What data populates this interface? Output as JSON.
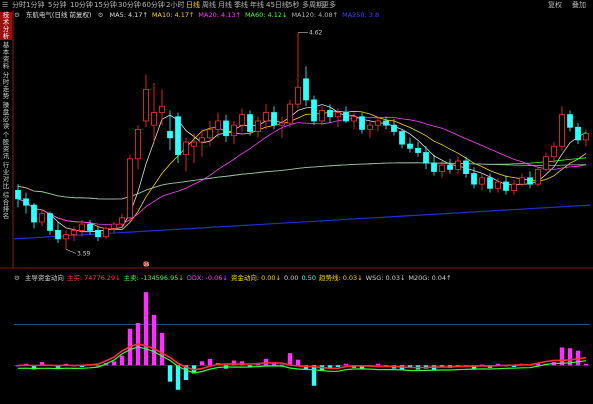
{
  "toolbar": {
    "items": [
      {
        "label": "分时",
        "active": false
      },
      {
        "label": "1分钟",
        "active": false
      },
      {
        "label": "5分钟",
        "active": false
      },
      {
        "label": "10分钟",
        "active": false
      },
      {
        "label": "15分钟",
        "active": false
      },
      {
        "label": "30分钟",
        "active": false
      },
      {
        "label": "60分钟",
        "active": false
      },
      {
        "label": "2小时",
        "active": false
      },
      {
        "label": "日线",
        "active": true
      },
      {
        "label": "周线",
        "active": false
      },
      {
        "label": "月线",
        "active": false
      },
      {
        "label": "季线",
        "active": false
      },
      {
        "label": "年线",
        "active": false
      },
      {
        "label": "45日线",
        "active": false
      },
      {
        "label": "5秒",
        "active": false
      },
      {
        "label": "多周期",
        "active": false
      },
      {
        "label": "更多",
        "active": false
      }
    ],
    "right_items": [
      "复权",
      "叠加"
    ]
  },
  "sidebar": [
    {
      "label": "技术分析",
      "hot": true
    },
    {
      "label": "基本资料",
      "hot": false
    },
    {
      "label": "分时走势",
      "hot": false
    },
    {
      "label": "操盘必读",
      "hot": false
    },
    {
      "label": "个股资讯",
      "hot": false
    },
    {
      "label": "行业对比",
      "hot": false
    },
    {
      "label": "综合排名",
      "hot": false
    }
  ],
  "main_legend": {
    "title": "东航电气(日线 前复权)",
    "items": [
      {
        "label": "MA5: 4.17↑",
        "color": "#e0e0e0"
      },
      {
        "label": "MA10: 4.17↑",
        "color": "#ffd700"
      },
      {
        "label": "MA20: 4.13↑",
        "color": "#ff40ff"
      },
      {
        "label": "MA60: 4.12↓",
        "color": "#40ff40"
      },
      {
        "label": "MA120: 4.08↑",
        "color": "#b0b0b0"
      },
      {
        "label": "MA250: 3.8",
        "color": "#4040ff"
      }
    ]
  },
  "sub_legend": {
    "items": [
      {
        "label": "主导资金动向",
        "color": "#d0d0d0"
      },
      {
        "label": "主买: 74776.29↓",
        "color": "#ff4040"
      },
      {
        "label": "主卖: -134596.95↓",
        "color": "#40ff40"
      },
      {
        "label": "DDX: -0.06↓",
        "color": "#ff40ff"
      },
      {
        "label": "资金动向: 0.00↓",
        "color": "#ffd700"
      },
      {
        "label": "0.00",
        "color": "#d0d0d0"
      },
      {
        "label": "0.50",
        "color": "#40ffff"
      },
      {
        "label": "趋势线: 0.03↓",
        "color": "#ffd700"
      },
      {
        "label": "WSG: 0.03↓",
        "color": "#d0d0d0"
      },
      {
        "label": "M20G: 0.04↑",
        "color": "#d0d0d0"
      }
    ]
  },
  "annotations": {
    "high_label": "4.62",
    "low_label": "3.59",
    "marker": "26"
  },
  "colors": {
    "up": "#ff3030",
    "down": "#30ffff",
    "bg": "#000000",
    "volume_line": "#4080c0"
  },
  "chart_data": {
    "type": "candlestick",
    "ylim": [
      3.53,
      4.67
    ],
    "candles": [
      {
        "o": 3.87,
        "h": 3.9,
        "l": 3.79,
        "c": 3.83
      },
      {
        "o": 3.83,
        "h": 3.86,
        "l": 3.76,
        "c": 3.8
      },
      {
        "o": 3.8,
        "h": 3.81,
        "l": 3.69,
        "c": 3.72
      },
      {
        "o": 3.72,
        "h": 3.78,
        "l": 3.7,
        "c": 3.76
      },
      {
        "o": 3.76,
        "h": 3.77,
        "l": 3.66,
        "c": 3.68
      },
      {
        "o": 3.68,
        "h": 3.72,
        "l": 3.62,
        "c": 3.64
      },
      {
        "o": 3.64,
        "h": 3.68,
        "l": 3.59,
        "c": 3.66
      },
      {
        "o": 3.66,
        "h": 3.7,
        "l": 3.63,
        "c": 3.68
      },
      {
        "o": 3.68,
        "h": 3.73,
        "l": 3.65,
        "c": 3.71
      },
      {
        "o": 3.71,
        "h": 3.73,
        "l": 3.66,
        "c": 3.68
      },
      {
        "o": 3.68,
        "h": 3.7,
        "l": 3.63,
        "c": 3.65
      },
      {
        "o": 3.65,
        "h": 3.7,
        "l": 3.64,
        "c": 3.69
      },
      {
        "o": 3.69,
        "h": 3.72,
        "l": 3.67,
        "c": 3.71
      },
      {
        "o": 3.71,
        "h": 3.76,
        "l": 3.69,
        "c": 3.74
      },
      {
        "o": 3.74,
        "h": 4.04,
        "l": 3.72,
        "c": 4.02
      },
      {
        "o": 4.02,
        "h": 4.18,
        "l": 3.97,
        "c": 4.16
      },
      {
        "o": 4.2,
        "h": 4.42,
        "l": 4.17,
        "c": 4.35
      },
      {
        "o": 4.18,
        "h": 4.38,
        "l": 4.1,
        "c": 4.24
      },
      {
        "o": 4.24,
        "h": 4.35,
        "l": 4.18,
        "c": 4.27
      },
      {
        "o": 4.15,
        "h": 4.25,
        "l": 4.06,
        "c": 4.12
      },
      {
        "o": 4.22,
        "h": 4.24,
        "l": 4.0,
        "c": 4.04
      },
      {
        "o": 4.04,
        "h": 4.12,
        "l": 3.96,
        "c": 4.1
      },
      {
        "o": 4.08,
        "h": 4.14,
        "l": 4.0,
        "c": 4.1
      },
      {
        "o": 4.1,
        "h": 4.16,
        "l": 4.03,
        "c": 4.12
      },
      {
        "o": 4.12,
        "h": 4.2,
        "l": 4.08,
        "c": 4.16
      },
      {
        "o": 4.16,
        "h": 4.24,
        "l": 4.12,
        "c": 4.2
      },
      {
        "o": 4.2,
        "h": 4.23,
        "l": 4.1,
        "c": 4.13
      },
      {
        "o": 4.13,
        "h": 4.2,
        "l": 4.09,
        "c": 4.18
      },
      {
        "o": 4.18,
        "h": 4.26,
        "l": 4.15,
        "c": 4.23
      },
      {
        "o": 4.23,
        "h": 4.25,
        "l": 4.13,
        "c": 4.15
      },
      {
        "o": 4.15,
        "h": 4.22,
        "l": 4.12,
        "c": 4.2
      },
      {
        "o": 4.2,
        "h": 4.28,
        "l": 4.16,
        "c": 4.24
      },
      {
        "o": 4.24,
        "h": 4.27,
        "l": 4.16,
        "c": 4.18
      },
      {
        "o": 4.18,
        "h": 4.22,
        "l": 4.12,
        "c": 4.19
      },
      {
        "o": 4.19,
        "h": 4.3,
        "l": 4.17,
        "c": 4.28
      },
      {
        "o": 4.28,
        "h": 4.62,
        "l": 4.26,
        "c": 4.36
      },
      {
        "o": 4.4,
        "h": 4.46,
        "l": 4.27,
        "c": 4.3
      },
      {
        "o": 4.3,
        "h": 4.32,
        "l": 4.18,
        "c": 4.2
      },
      {
        "o": 4.2,
        "h": 4.27,
        "l": 4.18,
        "c": 4.25
      },
      {
        "o": 4.25,
        "h": 4.28,
        "l": 4.19,
        "c": 4.22
      },
      {
        "o": 4.22,
        "h": 4.26,
        "l": 4.17,
        "c": 4.24
      },
      {
        "o": 4.24,
        "h": 4.27,
        "l": 4.19,
        "c": 4.2
      },
      {
        "o": 4.2,
        "h": 4.24,
        "l": 4.16,
        "c": 4.22
      },
      {
        "o": 4.22,
        "h": 4.24,
        "l": 4.14,
        "c": 4.16
      },
      {
        "o": 4.16,
        "h": 4.2,
        "l": 4.12,
        "c": 4.18
      },
      {
        "o": 4.18,
        "h": 4.22,
        "l": 4.15,
        "c": 4.2
      },
      {
        "o": 4.2,
        "h": 4.22,
        "l": 4.16,
        "c": 4.18
      },
      {
        "o": 4.18,
        "h": 4.21,
        "l": 4.13,
        "c": 4.15
      },
      {
        "o": 4.15,
        "h": 4.16,
        "l": 4.07,
        "c": 4.09
      },
      {
        "o": 4.09,
        "h": 4.12,
        "l": 4.05,
        "c": 4.07
      },
      {
        "o": 4.07,
        "h": 4.1,
        "l": 4.03,
        "c": 4.05
      },
      {
        "o": 4.05,
        "h": 4.08,
        "l": 3.97,
        "c": 4.0
      },
      {
        "o": 4.0,
        "h": 4.04,
        "l": 3.94,
        "c": 3.96
      },
      {
        "o": 3.96,
        "h": 4.01,
        "l": 3.93,
        "c": 3.99
      },
      {
        "o": 3.99,
        "h": 4.02,
        "l": 3.95,
        "c": 3.97
      },
      {
        "o": 3.97,
        "h": 4.03,
        "l": 3.95,
        "c": 4.01
      },
      {
        "o": 4.01,
        "h": 4.03,
        "l": 3.93,
        "c": 3.95
      },
      {
        "o": 3.95,
        "h": 3.98,
        "l": 3.88,
        "c": 3.9
      },
      {
        "o": 3.9,
        "h": 3.95,
        "l": 3.87,
        "c": 3.93
      },
      {
        "o": 3.93,
        "h": 3.95,
        "l": 3.86,
        "c": 3.88
      },
      {
        "o": 3.88,
        "h": 3.93,
        "l": 3.86,
        "c": 3.91
      },
      {
        "o": 3.91,
        "h": 3.94,
        "l": 3.85,
        "c": 3.87
      },
      {
        "o": 3.87,
        "h": 3.92,
        "l": 3.85,
        "c": 3.9
      },
      {
        "o": 3.9,
        "h": 3.95,
        "l": 3.89,
        "c": 3.93
      },
      {
        "o": 3.93,
        "h": 3.96,
        "l": 3.88,
        "c": 3.9
      },
      {
        "o": 3.9,
        "h": 3.98,
        "l": 3.89,
        "c": 3.97
      },
      {
        "o": 3.97,
        "h": 4.05,
        "l": 3.96,
        "c": 4.03
      },
      {
        "o": 4.03,
        "h": 4.1,
        "l": 4.0,
        "c": 4.08
      },
      {
        "o": 4.08,
        "h": 4.27,
        "l": 4.06,
        "c": 4.23
      },
      {
        "o": 4.23,
        "h": 4.25,
        "l": 4.15,
        "c": 4.17
      },
      {
        "o": 4.17,
        "h": 4.19,
        "l": 4.09,
        "c": 4.11
      },
      {
        "o": 4.11,
        "h": 4.16,
        "l": 4.08,
        "c": 4.14
      }
    ],
    "ma_series": [
      {
        "name": "MA5",
        "color": "#e0e0e0",
        "period": 5
      },
      {
        "name": "MA10",
        "color": "#ffd700",
        "period": 10
      },
      {
        "name": "MA20",
        "color": "#ff40ff",
        "period": 20
      },
      {
        "name": "MA60",
        "color": "#40ff40",
        "period": 60
      },
      {
        "name": "MA120",
        "color": "#b0b0b0",
        "period": 120
      }
    ],
    "ma250": {
      "start": 3.64,
      "end": 3.8,
      "color": "#2030d0"
    },
    "sub_panel": {
      "ylim": [
        -0.45,
        1.0
      ],
      "bars": [
        0,
        0.02,
        -0.05,
        0.04,
        0.01,
        -0.03,
        0.02,
        0.0,
        -0.02,
        0.01,
        0.0,
        0.03,
        0.05,
        0.12,
        0.45,
        0.52,
        0.9,
        0.62,
        0.4,
        -0.2,
        -0.3,
        -0.18,
        -0.1,
        0.05,
        0.08,
        0.03,
        -0.04,
        0.06,
        0.05,
        -0.02,
        0.03,
        0.08,
        0.04,
        0.01,
        0.15,
        0.07,
        -0.05,
        -0.25,
        -0.06,
        -0.03,
        -0.02,
        0.02,
        -0.03,
        -0.05,
        0.0,
        0.02,
        -0.02,
        -0.04,
        -0.06,
        -0.03,
        -0.05,
        -0.04,
        -0.06,
        -0.02,
        -0.03,
        -0.01,
        -0.02,
        -0.05,
        0.01,
        -0.03,
        0.02,
        0.0,
        -0.02,
        0.02,
        0.01,
        0.03,
        0.02,
        0.04,
        0.22,
        0.21,
        0.18,
        0.02
      ],
      "ref_level": 0.5
    }
  }
}
